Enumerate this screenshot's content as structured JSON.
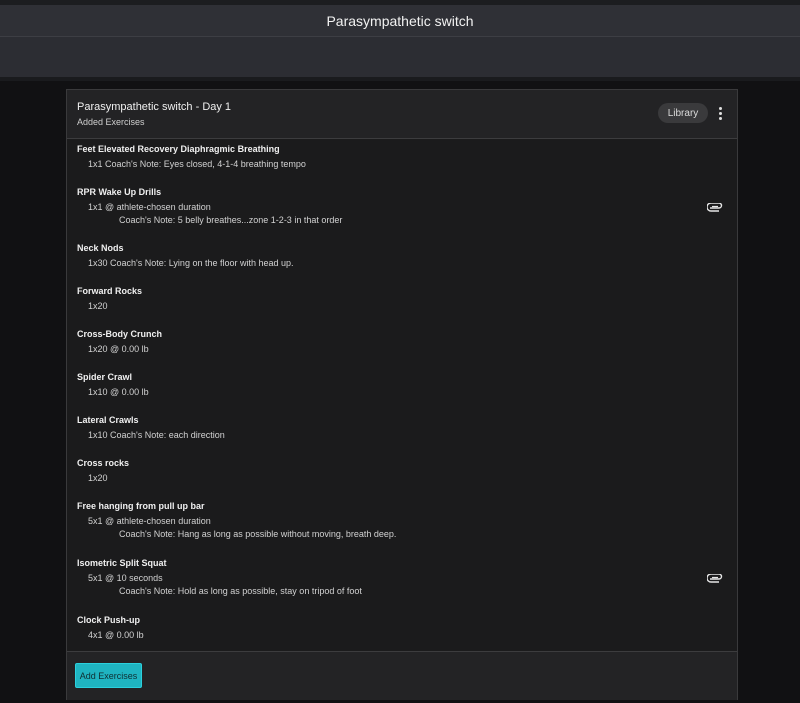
{
  "app": {
    "title": "Parasympathetic switch"
  },
  "card": {
    "title": "Parasympathetic switch - Day 1",
    "subtitle": "Added Exercises",
    "library_label": "Library",
    "more_icon": "more-vert-icon",
    "add_button_label": "Add Exercises"
  },
  "exercises": [
    {
      "name": "Feet Elevated Recovery Diaphragmic Breathing",
      "line": "1x1  Coach's Note: Eyes closed, 4-1-4 breathing tempo"
    },
    {
      "name": "RPR Wake Up Drills",
      "line": "1x1  @ athlete-chosen duration",
      "note": "Coach's Note: 5 belly breathes...zone 1-2-3 in that order",
      "attachment_icon": "paperclip-icon"
    },
    {
      "name": "Neck Nods",
      "line": "1x30  Coach's Note: Lying on the floor with head up."
    },
    {
      "name": "Forward Rocks",
      "line": "1x20"
    },
    {
      "name": "Cross-Body Crunch",
      "line": "1x20  @ 0.00 lb"
    },
    {
      "name": "Spider Crawl",
      "line": "1x10  @ 0.00 lb"
    },
    {
      "name": "Lateral Crawls",
      "line": "1x10  Coach's Note: each direction"
    },
    {
      "name": "Cross rocks",
      "line": "1x20"
    },
    {
      "name": "Free hanging from pull up bar",
      "line": "5x1  @ athlete-chosen duration",
      "note": "Coach's Note: Hang as long as possible without moving, breath deep."
    },
    {
      "name": "Isometric Split Squat",
      "line": "5x1  @ 10 seconds",
      "note": "Coach's Note: Hold as long as possible, stay on tripod of foot",
      "attachment_icon": "paperclip-icon"
    },
    {
      "name": "Clock Push-up",
      "line": "4x1  @ 0.00 lb"
    }
  ]
}
